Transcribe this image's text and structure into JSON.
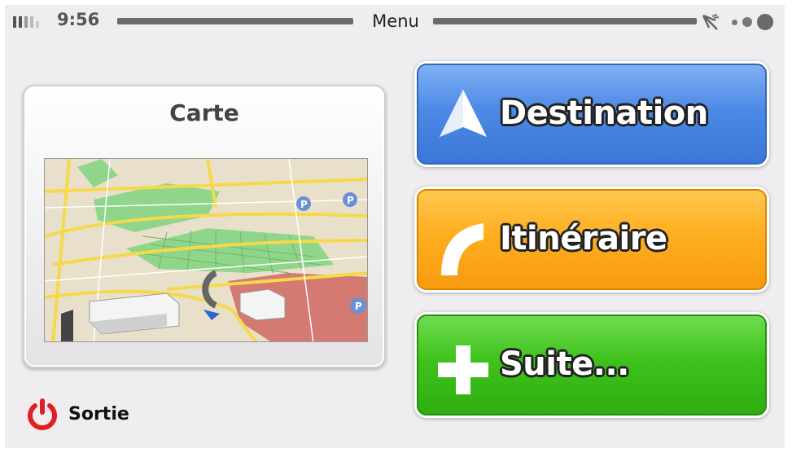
{
  "status_bar": {
    "time": "9:56",
    "title": "Menu",
    "signal_icon": "signal-bars-icon",
    "gps_icon": "satellite-dish-icon"
  },
  "map_card": {
    "title": "Carte",
    "preview_icon": "3d-map-preview"
  },
  "buttons": {
    "destination": {
      "label": "Destination",
      "icon": "navigation-arrow-icon",
      "color": "#4d8ae6"
    },
    "itineraire": {
      "label": "Itinéraire",
      "icon": "route-curve-icon",
      "color": "#ffae20"
    },
    "suite": {
      "label": "Suite...",
      "icon": "plus-icon",
      "color": "#3fc21c"
    }
  },
  "exit": {
    "label": "Sortie",
    "icon": "power-icon",
    "color": "#e02020"
  }
}
